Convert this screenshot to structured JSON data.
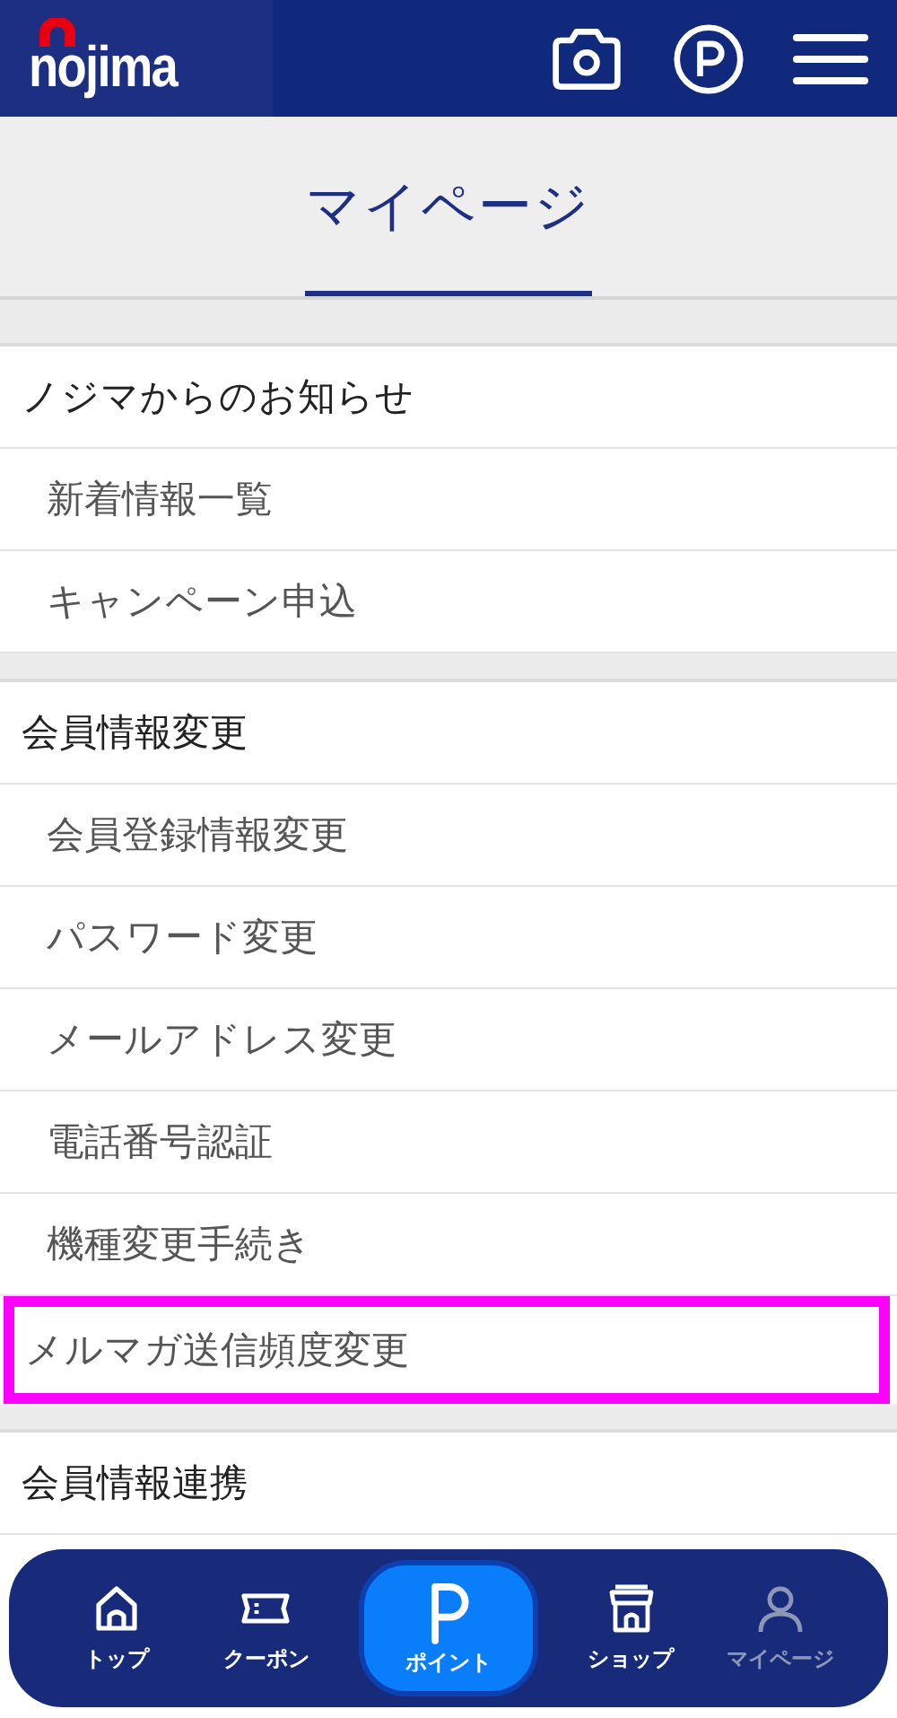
{
  "header": {
    "logo": "nojima"
  },
  "page_title": "マイページ",
  "sections": [
    {
      "title": "ノジマからのお知らせ",
      "items": [
        {
          "label": "新着情報一覧",
          "highlighted": false
        },
        {
          "label": "キャンペーン申込",
          "highlighted": false
        }
      ]
    },
    {
      "title": "会員情報変更",
      "items": [
        {
          "label": "会員登録情報変更",
          "highlighted": false
        },
        {
          "label": "パスワード変更",
          "highlighted": false
        },
        {
          "label": "メールアドレス変更",
          "highlighted": false
        },
        {
          "label": "電話番号認証",
          "highlighted": false
        },
        {
          "label": "機種変更手続き",
          "highlighted": false
        },
        {
          "label": "メルマガ送信頻度変更",
          "highlighted": true
        }
      ]
    },
    {
      "title": "会員情報連携"
    }
  ],
  "bottom_nav": [
    {
      "label": "トップ",
      "kind": "home",
      "selected": false
    },
    {
      "label": "クーポン",
      "kind": "coupon",
      "selected": false
    },
    {
      "label": "ポイント",
      "kind": "point",
      "selected": false
    },
    {
      "label": "ショップ",
      "kind": "shop",
      "selected": false
    },
    {
      "label": "マイページ",
      "kind": "user",
      "selected": true
    }
  ]
}
